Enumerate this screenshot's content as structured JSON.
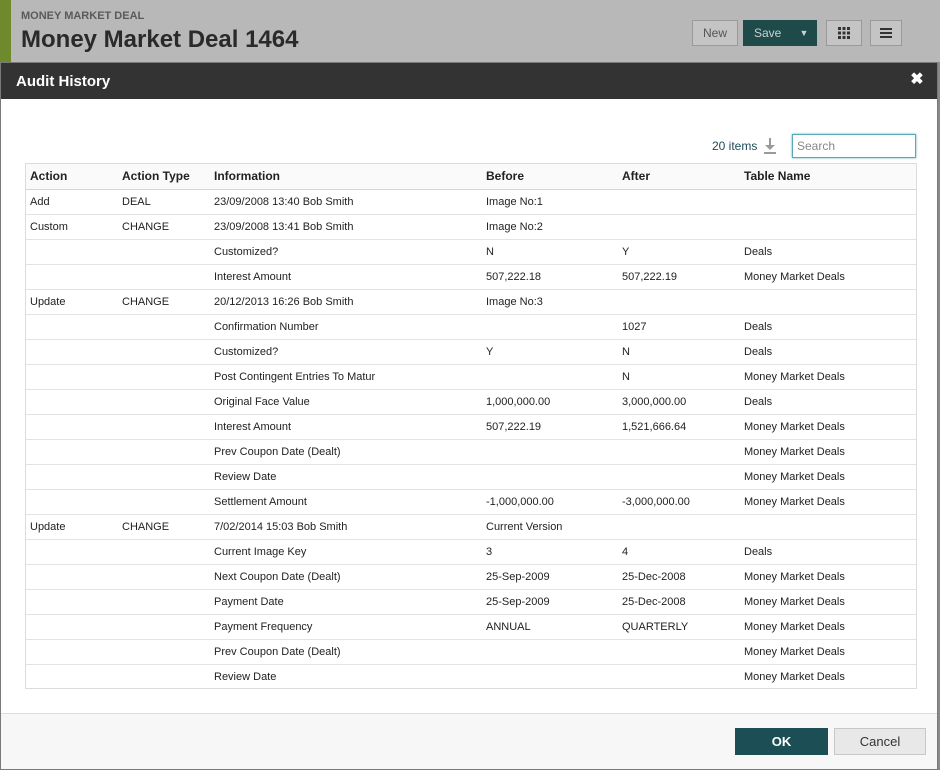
{
  "background": {
    "kicker": "MONEY MARKET DEAL",
    "title": "Money Market Deal 1464",
    "new_label": "New",
    "save_label": "Save",
    "caret": "▼"
  },
  "dialog": {
    "title": "Audit History",
    "close_glyph": "✖",
    "items_count": "20 items",
    "search_placeholder": "Search",
    "columns": [
      "Action",
      "Action Type",
      "Information",
      "Before",
      "After",
      "Table Name"
    ],
    "rows": [
      [
        "Add",
        "DEAL",
        "23/09/2008 13:40 Bob Smith",
        "Image No:1",
        "",
        ""
      ],
      [
        "Custom",
        "CHANGE",
        "23/09/2008 13:41 Bob Smith",
        "Image No:2",
        "",
        ""
      ],
      [
        "",
        "",
        "Customized?",
        "N",
        "Y",
        "Deals"
      ],
      [
        "",
        "",
        "Interest Amount",
        "507,222.18",
        "507,222.19",
        "Money Market Deals"
      ],
      [
        "Update",
        "CHANGE",
        "20/12/2013 16:26 Bob Smith",
        "Image No:3",
        "",
        ""
      ],
      [
        "",
        "",
        "Confirmation Number",
        "",
        "1027",
        "Deals"
      ],
      [
        "",
        "",
        "Customized?",
        "Y",
        "N",
        "Deals"
      ],
      [
        "",
        "",
        "Post Contingent Entries To Matur",
        "",
        "N",
        "Money Market Deals"
      ],
      [
        "",
        "",
        "Original Face Value",
        "1,000,000.00",
        "3,000,000.00",
        "Deals"
      ],
      [
        "",
        "",
        "Interest Amount",
        "507,222.19",
        "1,521,666.64",
        "Money Market Deals"
      ],
      [
        "",
        "",
        "Prev Coupon Date (Dealt)",
        "",
        "",
        "Money Market Deals"
      ],
      [
        "",
        "",
        "Review Date",
        "",
        "",
        "Money Market Deals"
      ],
      [
        "",
        "",
        "Settlement Amount",
        "-1,000,000.00",
        "-3,000,000.00",
        "Money Market Deals"
      ],
      [
        "Update",
        "CHANGE",
        "7/02/2014 15:03 Bob Smith",
        "Current Version",
        "",
        ""
      ],
      [
        "",
        "",
        "Current Image Key",
        "3",
        "4",
        "Deals"
      ],
      [
        "",
        "",
        "Next Coupon Date (Dealt)",
        "25-Sep-2009",
        "25-Dec-2008",
        "Money Market Deals"
      ],
      [
        "",
        "",
        "Payment Date",
        "25-Sep-2009",
        "25-Dec-2008",
        "Money Market Deals"
      ],
      [
        "",
        "",
        "Payment Frequency",
        "ANNUAL",
        "QUARTERLY",
        "Money Market Deals"
      ],
      [
        "",
        "",
        "Prev Coupon Date (Dealt)",
        "",
        "",
        "Money Market Deals"
      ],
      [
        "",
        "",
        "Review Date",
        "",
        "",
        "Money Market Deals"
      ]
    ],
    "ok_label": "OK",
    "cancel_label": "Cancel"
  },
  "icons": {
    "download": "download-icon",
    "grid": "grid-icon",
    "menu": "hamburger-menu-icon",
    "close": "close-icon"
  },
  "colors": {
    "header_bg": "#333333",
    "primary_button": "#1c4f55",
    "accent": "#6e8a2d"
  }
}
